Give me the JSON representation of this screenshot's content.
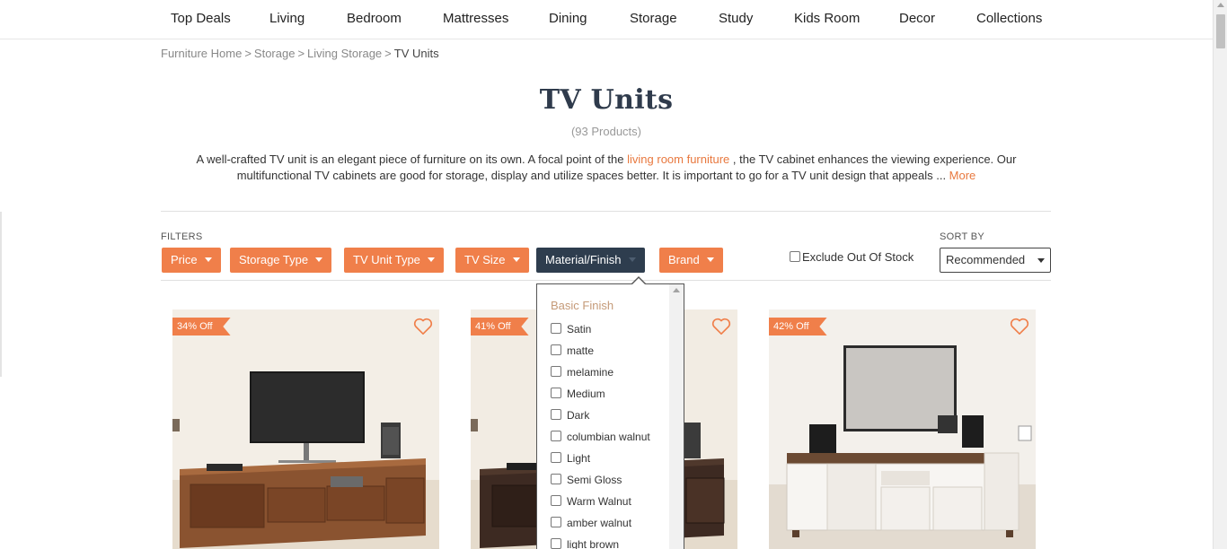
{
  "nav": {
    "items": [
      "Top Deals",
      "Living",
      "Bedroom",
      "Mattresses",
      "Dining",
      "Storage",
      "Study",
      "Kids Room",
      "Decor",
      "Collections"
    ]
  },
  "breadcrumb": {
    "items": [
      "Furniture Home",
      "Storage",
      "Living Storage"
    ],
    "separator": ">",
    "current": "TV Units"
  },
  "page": {
    "title": "TV Units",
    "count": "(93 Products)",
    "description_part1": "A well-crafted TV unit is an elegant piece of furniture on its own. A focal point of the ",
    "description_link": "living room furniture",
    "description_part2": " , the TV cabinet enhances the viewing experience. Our multifunctional TV cabinets are good for storage, display and utilize spaces better. It is important to go for a TV unit design that appeals ... ",
    "more_link": "More"
  },
  "filters": {
    "label": "FILTERS",
    "buttons": [
      "Price",
      "Storage Type",
      "TV Unit Type",
      "TV Size",
      "Material/Finish",
      "Brand"
    ],
    "active": "Material/Finish",
    "exclude_out_of_stock": "Exclude Out Of Stock",
    "exclude_checked": false
  },
  "sort": {
    "label": "SORT BY",
    "selected": "Recommended"
  },
  "dropdown": {
    "section_title": "Basic Finish",
    "options": [
      "Satin",
      "matte",
      "melamine",
      "Medium",
      "Dark",
      "columbian walnut",
      "Light",
      "Semi Gloss",
      "Warm Walnut",
      "amber walnut",
      "light brown"
    ]
  },
  "products": [
    {
      "discount": "34% Off"
    },
    {
      "discount": "41% Off"
    },
    {
      "discount": "42% Off"
    }
  ],
  "colors": {
    "accent": "#f07f4a",
    "active_filter": "#2e3d4e",
    "link": "#e8783e",
    "title": "#2f3b4c",
    "section_title": "#c59a78"
  },
  "icons": {
    "wishlist": "heart-outline-icon",
    "dropdown_caret": "caret-down-icon"
  }
}
